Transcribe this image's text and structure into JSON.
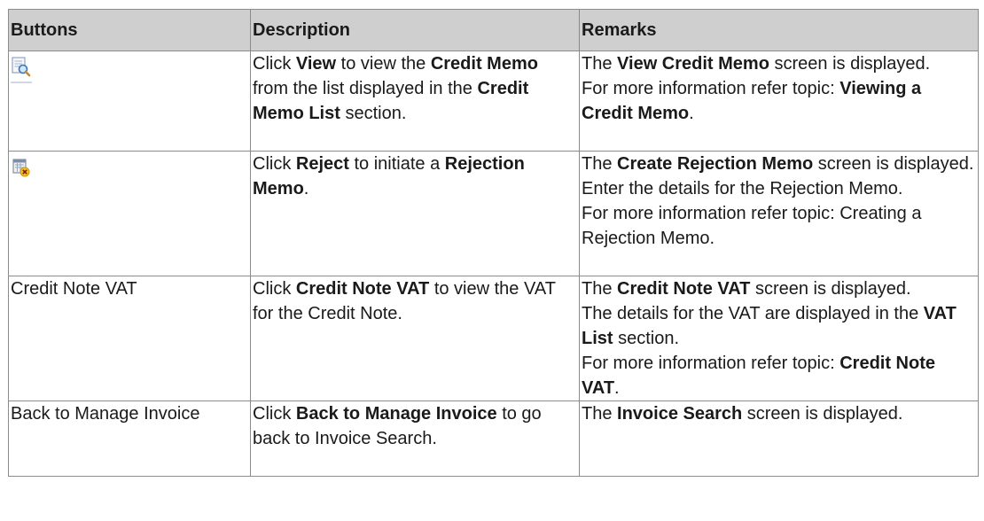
{
  "headers": [
    "Buttons",
    "Description",
    "Remarks"
  ],
  "rows": [
    {
      "button": {
        "icon": "view-icon",
        "label": ""
      },
      "desc": [
        "Click ",
        "View",
        " to view the ",
        "Credit Memo",
        " from the list displayed in the ",
        "Credit Memo List",
        " section."
      ],
      "remarks": [
        [
          "The ",
          "View Credit Memo",
          " screen is displayed."
        ],
        [
          "For more information refer topic: ",
          "Viewing a Credit Memo",
          "."
        ]
      ]
    },
    {
      "button": {
        "icon": "reject-icon",
        "label": ""
      },
      "desc": [
        "Click ",
        "Reject",
        " to initiate a ",
        "Rejection Memo",
        "."
      ],
      "remarks": [
        [
          "The ",
          "Create Rejection Memo",
          " screen is displayed."
        ],
        [
          "Enter the details for the Rejection Memo."
        ],
        [
          "For more information refer topic: Creating a Rejection Memo."
        ]
      ]
    },
    {
      "button": {
        "icon": "",
        "label": "Credit Note VAT"
      },
      "desc": [
        "Click ",
        "Credit Note VAT",
        " to view the VAT for the Credit Note."
      ],
      "remarks": [
        [
          "The ",
          "Credit Note VAT",
          " screen is displayed."
        ],
        [
          "The details for the VAT are displayed in the ",
          "VAT List",
          " section."
        ],
        [
          "For more information refer topic: ",
          "Credit Note VAT",
          "."
        ]
      ]
    },
    {
      "button": {
        "icon": "",
        "label": "Back to Manage Invoice"
      },
      "desc": [
        "Click ",
        "Back to Manage Invoice",
        " to go back to Invoice Search."
      ],
      "remarks": [
        [
          "The ",
          "Invoice Search",
          " screen is displayed."
        ]
      ]
    }
  ]
}
